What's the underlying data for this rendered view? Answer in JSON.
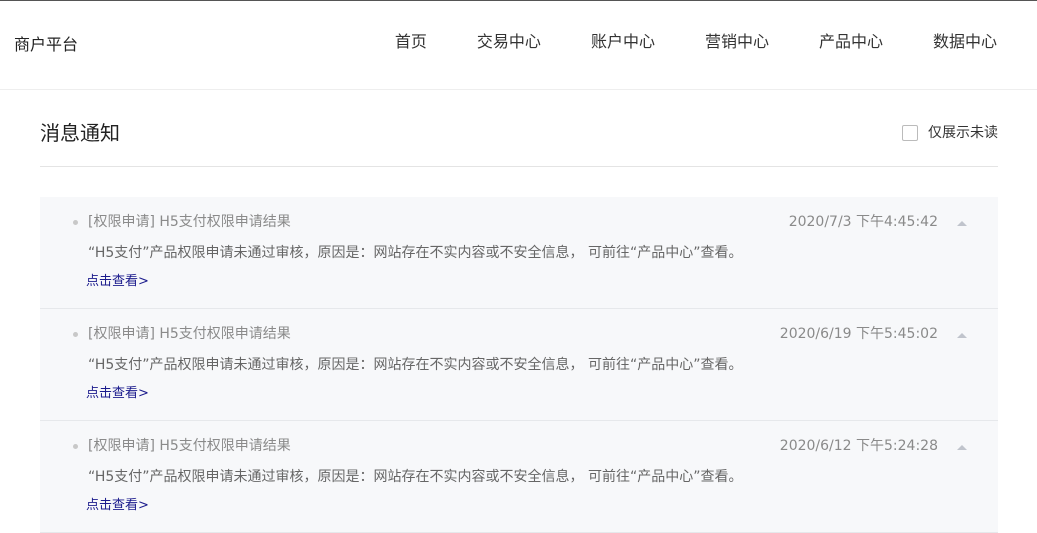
{
  "header": {
    "brand": "商户平台",
    "nav": [
      "首页",
      "交易中心",
      "账户中心",
      "营销中心",
      "产品中心",
      "数据中心"
    ]
  },
  "page": {
    "title": "消息通知",
    "unread_only_label": "仅展示未读",
    "unread_only_checked": false
  },
  "messages": [
    {
      "title": "[权限申请] H5支付权限申请结果",
      "time": "2020/7/3 下午4:45:42",
      "body": "“H5支付”产品权限申请未通过审核，原因是：网站存在不实内容或不安全信息， 可前往“产品中心”查看。",
      "link": "点击查看>"
    },
    {
      "title": "[权限申请] H5支付权限申请结果",
      "time": "2020/6/19 下午5:45:02",
      "body": "“H5支付”产品权限申请未通过审核，原因是：网站存在不实内容或不安全信息， 可前往“产品中心”查看。",
      "link": "点击查看>"
    },
    {
      "title": "[权限申请] H5支付权限申请结果",
      "time": "2020/6/12 下午5:24:28",
      "body": "“H5支付”产品权限申请未通过审核，原因是：网站存在不实内容或不安全信息， 可前往“产品中心”查看。",
      "link": "点击查看>"
    }
  ],
  "icons": {
    "dot": "bullet-dot-icon",
    "collapse": "chevron-up-icon"
  },
  "colors": {
    "link": "#1a1a8c",
    "card_bg": "#f7f8fa",
    "muted_text": "#8a8a8a"
  }
}
